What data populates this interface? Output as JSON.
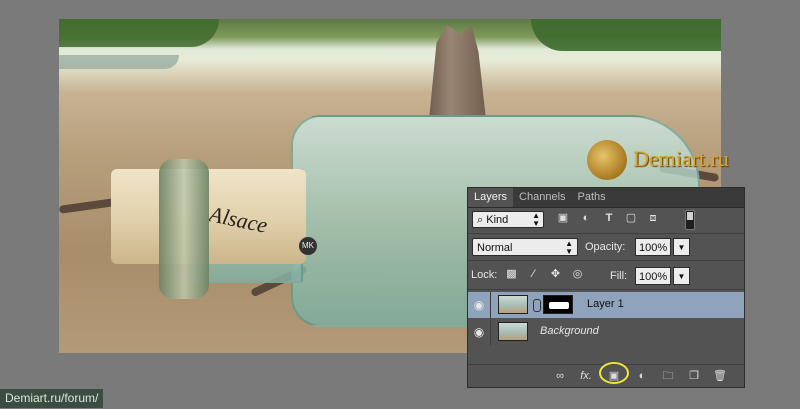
{
  "canvas": {
    "cork_text": "Alsace",
    "cork_badge": "MK"
  },
  "watermark": {
    "text": "Demiart.ru"
  },
  "layers_panel": {
    "tabs": [
      {
        "label": "Layers",
        "active": true
      },
      {
        "label": "Channels",
        "active": false
      },
      {
        "label": "Paths",
        "active": false
      }
    ],
    "filter": {
      "label": "Kind",
      "icons": [
        "pixel-filter-icon",
        "adjustment-filter-icon",
        "type-filter-icon",
        "shape-filter-icon",
        "smart-object-filter-icon"
      ]
    },
    "blend_mode": "Normal",
    "opacity_label": "Opacity:",
    "opacity_value": "100%",
    "lock_label": "Lock:",
    "fill_label": "Fill:",
    "fill_value": "100%",
    "layers": [
      {
        "name": "Layer 1",
        "selected": true,
        "has_mask": true
      },
      {
        "name": "Background",
        "selected": false,
        "has_mask": false
      }
    ],
    "bottom_icons": [
      "link-layers-icon",
      "fx-icon",
      "add-mask-icon",
      "adjustment-layer-icon",
      "group-icon",
      "new-layer-icon",
      "trash-icon"
    ],
    "highlight_color": "#f0e63a"
  },
  "footer": {
    "forum_link": "Demiart.ru/forum/"
  }
}
